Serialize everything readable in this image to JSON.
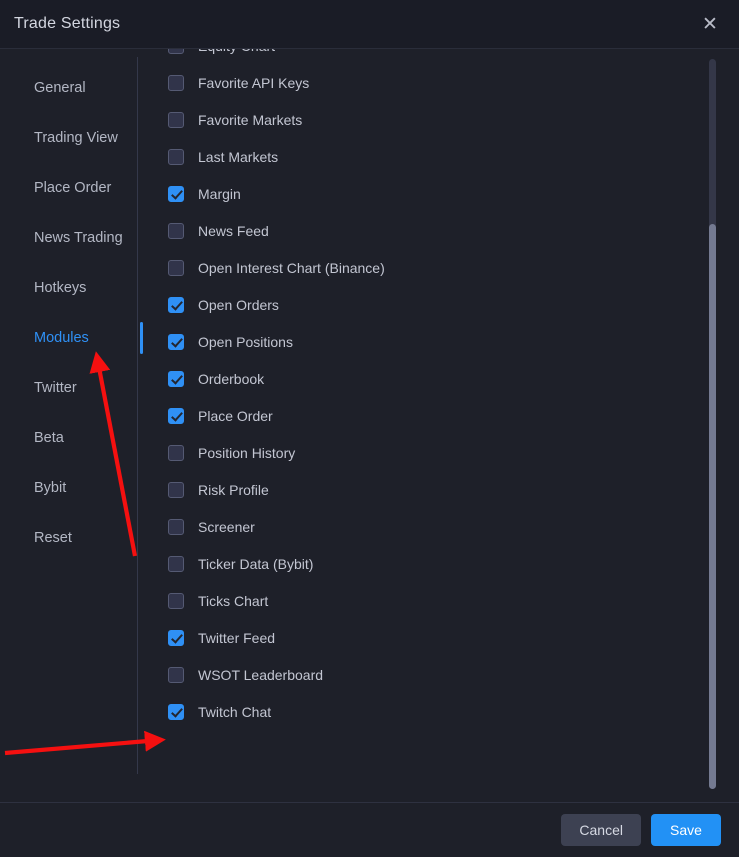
{
  "window": {
    "title": "Trade Settings",
    "close_icon": "close-icon",
    "close_glyph": "✕"
  },
  "sidebar": {
    "items": [
      {
        "label": "General",
        "active": false
      },
      {
        "label": "Trading View",
        "active": false
      },
      {
        "label": "Place Order",
        "active": false
      },
      {
        "label": "News Trading",
        "active": false
      },
      {
        "label": "Hotkeys",
        "active": false
      },
      {
        "label": "Modules",
        "active": true
      },
      {
        "label": "Twitter",
        "active": false
      },
      {
        "label": "Beta",
        "active": false
      },
      {
        "label": "Bybit",
        "active": false
      },
      {
        "label": "Reset",
        "active": false
      }
    ]
  },
  "modules": {
    "items": [
      {
        "label": "Equity Chart",
        "checked": false
      },
      {
        "label": "Favorite API Keys",
        "checked": false
      },
      {
        "label": "Favorite Markets",
        "checked": false
      },
      {
        "label": "Last Markets",
        "checked": false
      },
      {
        "label": "Margin",
        "checked": true
      },
      {
        "label": "News Feed",
        "checked": false
      },
      {
        "label": "Open Interest Chart (Binance)",
        "checked": false
      },
      {
        "label": "Open Orders",
        "checked": true
      },
      {
        "label": "Open Positions",
        "checked": true
      },
      {
        "label": "Orderbook",
        "checked": true
      },
      {
        "label": "Place Order",
        "checked": true
      },
      {
        "label": "Position History",
        "checked": false
      },
      {
        "label": "Risk Profile",
        "checked": false
      },
      {
        "label": "Screener",
        "checked": false
      },
      {
        "label": "Ticker Data (Bybit)",
        "checked": false
      },
      {
        "label": "Ticks Chart",
        "checked": false
      },
      {
        "label": "Twitter Feed",
        "checked": true
      },
      {
        "label": "WSOT Leaderboard",
        "checked": false
      },
      {
        "label": "Twitch Chat",
        "checked": true
      }
    ]
  },
  "footer": {
    "cancel_label": "Cancel",
    "save_label": "Save"
  },
  "colors": {
    "accent": "#2f90f5",
    "save_button": "#2291f5",
    "cancel_button": "#3d4152",
    "annotation_arrow": "#f51010",
    "dialog_bg": "#1e2029",
    "header_bg": "#1a1c26"
  }
}
